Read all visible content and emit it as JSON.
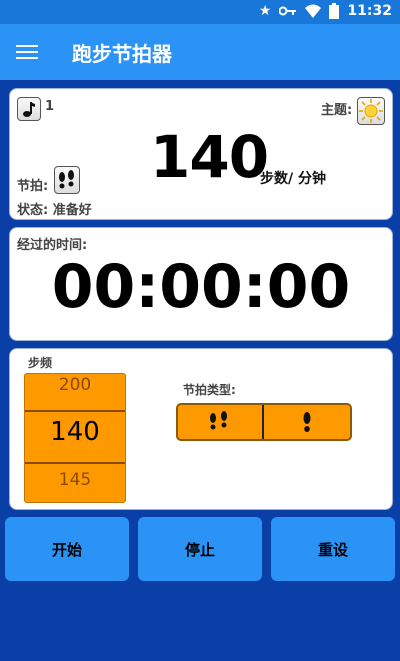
{
  "status": {
    "time": "11:32"
  },
  "appbar": {
    "title": "跑步节拍器"
  },
  "card1": {
    "music_count": "1",
    "theme_label": "主题:",
    "bpm": "140",
    "bpm_unit": "步数/ 分钟",
    "beat_label": "节拍:",
    "state_label": "状态: 准备好"
  },
  "card2": {
    "elapsed_label": "经过的时间:",
    "timer": "00:00:00"
  },
  "card3": {
    "cadence_label": "步频",
    "picker_prev": "200",
    "picker_value": "140",
    "picker_next": "145",
    "beat_type_label": "节拍类型:"
  },
  "buttons": {
    "start": "开始",
    "stop": "停止",
    "reset": "重设"
  },
  "colors": {
    "background": "#0a3fa8",
    "appbar": "#2b93f5",
    "accent_orange": "#ff9900"
  }
}
